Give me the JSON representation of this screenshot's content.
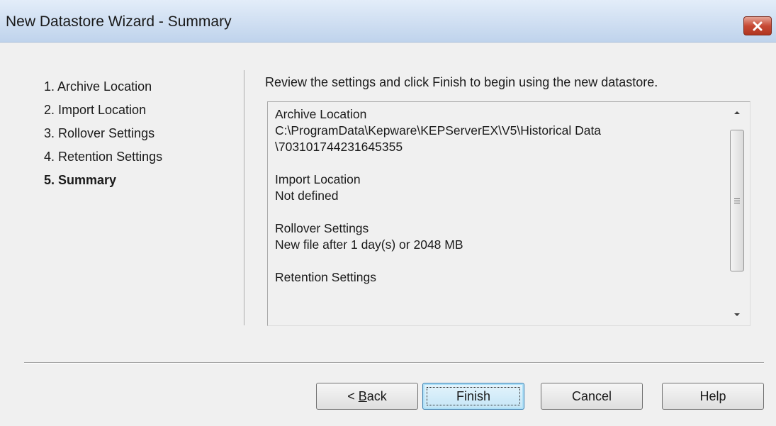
{
  "window": {
    "title": "New Datastore Wizard - Summary",
    "close_icon": "close-icon"
  },
  "steps": [
    {
      "label": "1. Archive Location",
      "active": false
    },
    {
      "label": "2. Import Location",
      "active": false
    },
    {
      "label": "3. Rollover Settings",
      "active": false
    },
    {
      "label": "4. Retention Settings",
      "active": false
    },
    {
      "label": "5. Summary",
      "active": true
    }
  ],
  "instruction": "Review the settings and click Finish to begin using the new datastore.",
  "summary": {
    "archive_heading": "Archive Location",
    "archive_path_line1": "C:\\ProgramData\\Kepware\\KEPServerEX\\V5\\Historical Data",
    "archive_path_line2": "\\703101744231645355",
    "import_heading": "Import Location",
    "import_value": "Not defined",
    "rollover_heading": "Rollover Settings",
    "rollover_value": "New file after 1 day(s) or 2048 MB",
    "retention_heading": "Retention Settings"
  },
  "buttons": {
    "back_prefix": "< ",
    "back_mnemonic": "B",
    "back_rest": "ack",
    "finish": "Finish",
    "cancel": "Cancel",
    "help": "Help"
  },
  "colors": {
    "titlebar": "#bfd3ec",
    "close_button": "#c74a35",
    "dialog_bg": "#f0f0f0",
    "default_button_border": "#3c7fb1"
  }
}
